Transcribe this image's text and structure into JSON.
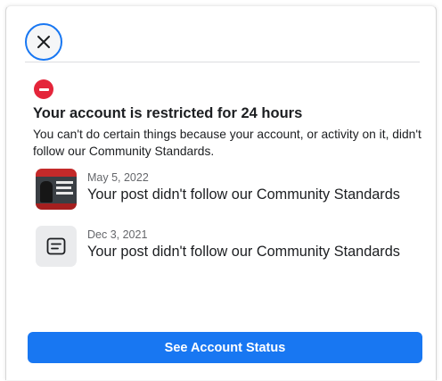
{
  "dialog": {
    "headline": "Your account is restricted for 24 hours",
    "description": "You can't do certain things because your account, or activity on it, didn't follow our Community Standards.",
    "items": [
      {
        "date": "May 5, 2022",
        "title": "Your post didn't follow our Community Standards",
        "thumbnail": "post-image"
      },
      {
        "date": "Dec 3, 2021",
        "title": "Your post didn't follow our Community Standards",
        "thumbnail": "post-text-icon"
      }
    ],
    "primary_button": "See Account Status"
  },
  "icons": {
    "close": "close-icon",
    "restriction": "stop-icon",
    "post": "post-text-icon"
  },
  "colors": {
    "accent": "#1877f2",
    "danger": "#e4253a",
    "text_primary": "#1c1e21",
    "text_secondary": "#65676b"
  }
}
